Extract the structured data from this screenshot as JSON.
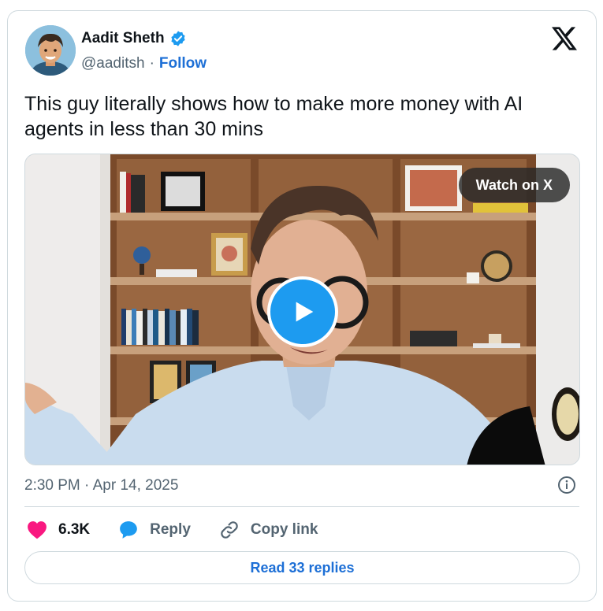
{
  "author": {
    "name": "Aadit Sheth",
    "handle": "@aaditsh",
    "separator": "·",
    "follow_label": "Follow",
    "verified": true
  },
  "tweet": {
    "text": "This guy literally shows how to make more money with AI agents in less than 30 mins"
  },
  "media": {
    "watch_label": "Watch on X",
    "type": "video"
  },
  "meta": {
    "timestamp": "2:30 PM · Apr 14, 2025"
  },
  "actions": {
    "like_count": "6.3K",
    "reply_label": "Reply",
    "copy_label": "Copy link"
  },
  "read_replies_label": "Read 33 replies",
  "icons": [
    "verified-badge-icon",
    "x-logo-icon",
    "play-icon",
    "info-icon",
    "heart-icon",
    "reply-bubble-icon",
    "link-icon"
  ],
  "colors": {
    "accent": "#1d9bf0",
    "link": "#1d6fd6",
    "like": "#f91880",
    "muted": "#536471",
    "border": "#cfd9de"
  }
}
